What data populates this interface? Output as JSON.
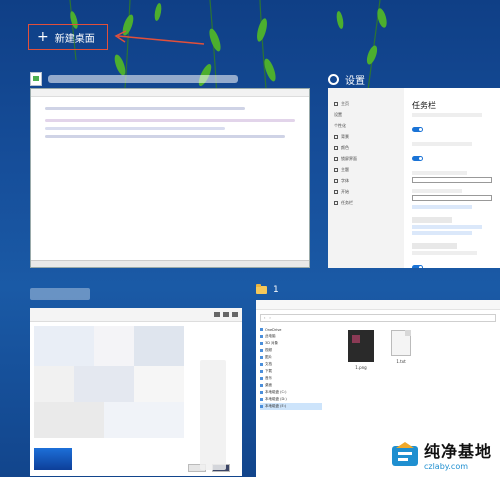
{
  "header": {
    "new_desktop_label": "新建桌面",
    "plus_glyph": "+"
  },
  "windows": {
    "settings": {
      "title": "设置",
      "sidebar_items": [
        "主页",
        "设置",
        "个性化",
        "背景",
        "颜色",
        "锁屏界面",
        "主题",
        "字体",
        "开始",
        "任务栏"
      ],
      "section_title": "任务栏",
      "toggle_label": "开"
    },
    "explorer": {
      "title": "1",
      "sidebar_items": [
        "OneDrive",
        "此电脑",
        "3D 对象",
        "视频",
        "图片",
        "文档",
        "下载",
        "音乐",
        "桌面",
        "本地磁盘 (C:)",
        "本地磁盘 (D:)",
        "本地磁盘 (E:)"
      ],
      "files": [
        {
          "name": "1.png",
          "type": "image"
        },
        {
          "name": "1.txt",
          "type": "text"
        }
      ]
    }
  },
  "watermark": {
    "name": "纯净基地",
    "url": "czlaby.com"
  },
  "colors": {
    "accent_box": "#e2503a",
    "toggle_blue": "#1a73d6",
    "bg_top": "#0f3f86"
  }
}
